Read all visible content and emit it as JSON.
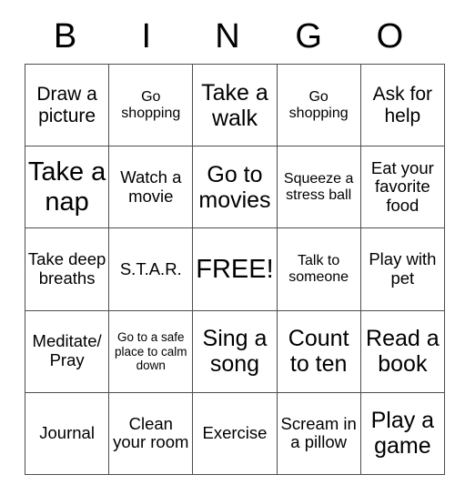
{
  "card": {
    "title_letters": [
      "B",
      "I",
      "N",
      "G",
      "O"
    ],
    "rows": [
      [
        {
          "text": "Draw a picture",
          "size": "lg"
        },
        {
          "text": "Go shopping",
          "size": "sm"
        },
        {
          "text": "Take a walk",
          "size": "xl"
        },
        {
          "text": "Go shopping",
          "size": "sm"
        },
        {
          "text": "Ask for help",
          "size": "lg"
        }
      ],
      [
        {
          "text": "Take a nap",
          "size": "xxl"
        },
        {
          "text": "Watch a movie",
          "size": "md"
        },
        {
          "text": "Go to movies",
          "size": "xl"
        },
        {
          "text": "Squeeze a stress ball",
          "size": "sm"
        },
        {
          "text": "Eat your favorite food",
          "size": "md"
        }
      ],
      [
        {
          "text": "Take deep breaths",
          "size": "md"
        },
        {
          "text": "S.T.A.R.",
          "size": "md"
        },
        {
          "text": "FREE!",
          "size": "xxl"
        },
        {
          "text": "Talk to someone",
          "size": "sm"
        },
        {
          "text": "Play with pet",
          "size": "md"
        }
      ],
      [
        {
          "text": "Meditate/ Pray",
          "size": "md"
        },
        {
          "text": "Go to a safe place to calm down",
          "size": "xs"
        },
        {
          "text": "Sing a song",
          "size": "xl"
        },
        {
          "text": "Count to ten",
          "size": "xl"
        },
        {
          "text": "Read a book",
          "size": "xl"
        }
      ],
      [
        {
          "text": "Journal",
          "size": "md"
        },
        {
          "text": "Clean your room",
          "size": "md"
        },
        {
          "text": "Exercise",
          "size": "md"
        },
        {
          "text": "Scream in a pillow",
          "size": "md"
        },
        {
          "text": "Play a game",
          "size": "xl"
        }
      ]
    ]
  },
  "colors": {
    "background": "#ffffff",
    "text": "#000000",
    "grid_line": "#4d4d4d"
  }
}
